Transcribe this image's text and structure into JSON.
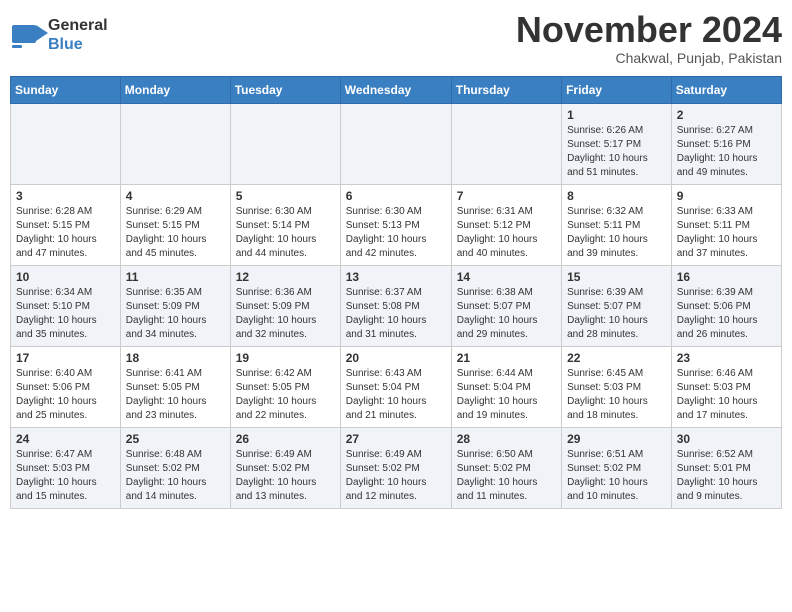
{
  "header": {
    "logo_line1": "General",
    "logo_line2": "Blue",
    "month_title": "November 2024",
    "subtitle": "Chakwal, Punjab, Pakistan"
  },
  "days_of_week": [
    "Sunday",
    "Monday",
    "Tuesday",
    "Wednesday",
    "Thursday",
    "Friday",
    "Saturday"
  ],
  "weeks": [
    [
      {
        "day": "",
        "info": ""
      },
      {
        "day": "",
        "info": ""
      },
      {
        "day": "",
        "info": ""
      },
      {
        "day": "",
        "info": ""
      },
      {
        "day": "",
        "info": ""
      },
      {
        "day": "1",
        "info": "Sunrise: 6:26 AM\nSunset: 5:17 PM\nDaylight: 10 hours and 51 minutes."
      },
      {
        "day": "2",
        "info": "Sunrise: 6:27 AM\nSunset: 5:16 PM\nDaylight: 10 hours and 49 minutes."
      }
    ],
    [
      {
        "day": "3",
        "info": "Sunrise: 6:28 AM\nSunset: 5:15 PM\nDaylight: 10 hours and 47 minutes."
      },
      {
        "day": "4",
        "info": "Sunrise: 6:29 AM\nSunset: 5:15 PM\nDaylight: 10 hours and 45 minutes."
      },
      {
        "day": "5",
        "info": "Sunrise: 6:30 AM\nSunset: 5:14 PM\nDaylight: 10 hours and 44 minutes."
      },
      {
        "day": "6",
        "info": "Sunrise: 6:30 AM\nSunset: 5:13 PM\nDaylight: 10 hours and 42 minutes."
      },
      {
        "day": "7",
        "info": "Sunrise: 6:31 AM\nSunset: 5:12 PM\nDaylight: 10 hours and 40 minutes."
      },
      {
        "day": "8",
        "info": "Sunrise: 6:32 AM\nSunset: 5:11 PM\nDaylight: 10 hours and 39 minutes."
      },
      {
        "day": "9",
        "info": "Sunrise: 6:33 AM\nSunset: 5:11 PM\nDaylight: 10 hours and 37 minutes."
      }
    ],
    [
      {
        "day": "10",
        "info": "Sunrise: 6:34 AM\nSunset: 5:10 PM\nDaylight: 10 hours and 35 minutes."
      },
      {
        "day": "11",
        "info": "Sunrise: 6:35 AM\nSunset: 5:09 PM\nDaylight: 10 hours and 34 minutes."
      },
      {
        "day": "12",
        "info": "Sunrise: 6:36 AM\nSunset: 5:09 PM\nDaylight: 10 hours and 32 minutes."
      },
      {
        "day": "13",
        "info": "Sunrise: 6:37 AM\nSunset: 5:08 PM\nDaylight: 10 hours and 31 minutes."
      },
      {
        "day": "14",
        "info": "Sunrise: 6:38 AM\nSunset: 5:07 PM\nDaylight: 10 hours and 29 minutes."
      },
      {
        "day": "15",
        "info": "Sunrise: 6:39 AM\nSunset: 5:07 PM\nDaylight: 10 hours and 28 minutes."
      },
      {
        "day": "16",
        "info": "Sunrise: 6:39 AM\nSunset: 5:06 PM\nDaylight: 10 hours and 26 minutes."
      }
    ],
    [
      {
        "day": "17",
        "info": "Sunrise: 6:40 AM\nSunset: 5:06 PM\nDaylight: 10 hours and 25 minutes."
      },
      {
        "day": "18",
        "info": "Sunrise: 6:41 AM\nSunset: 5:05 PM\nDaylight: 10 hours and 23 minutes."
      },
      {
        "day": "19",
        "info": "Sunrise: 6:42 AM\nSunset: 5:05 PM\nDaylight: 10 hours and 22 minutes."
      },
      {
        "day": "20",
        "info": "Sunrise: 6:43 AM\nSunset: 5:04 PM\nDaylight: 10 hours and 21 minutes."
      },
      {
        "day": "21",
        "info": "Sunrise: 6:44 AM\nSunset: 5:04 PM\nDaylight: 10 hours and 19 minutes."
      },
      {
        "day": "22",
        "info": "Sunrise: 6:45 AM\nSunset: 5:03 PM\nDaylight: 10 hours and 18 minutes."
      },
      {
        "day": "23",
        "info": "Sunrise: 6:46 AM\nSunset: 5:03 PM\nDaylight: 10 hours and 17 minutes."
      }
    ],
    [
      {
        "day": "24",
        "info": "Sunrise: 6:47 AM\nSunset: 5:03 PM\nDaylight: 10 hours and 15 minutes."
      },
      {
        "day": "25",
        "info": "Sunrise: 6:48 AM\nSunset: 5:02 PM\nDaylight: 10 hours and 14 minutes."
      },
      {
        "day": "26",
        "info": "Sunrise: 6:49 AM\nSunset: 5:02 PM\nDaylight: 10 hours and 13 minutes."
      },
      {
        "day": "27",
        "info": "Sunrise: 6:49 AM\nSunset: 5:02 PM\nDaylight: 10 hours and 12 minutes."
      },
      {
        "day": "28",
        "info": "Sunrise: 6:50 AM\nSunset: 5:02 PM\nDaylight: 10 hours and 11 minutes."
      },
      {
        "day": "29",
        "info": "Sunrise: 6:51 AM\nSunset: 5:02 PM\nDaylight: 10 hours and 10 minutes."
      },
      {
        "day": "30",
        "info": "Sunrise: 6:52 AM\nSunset: 5:01 PM\nDaylight: 10 hours and 9 minutes."
      }
    ]
  ]
}
